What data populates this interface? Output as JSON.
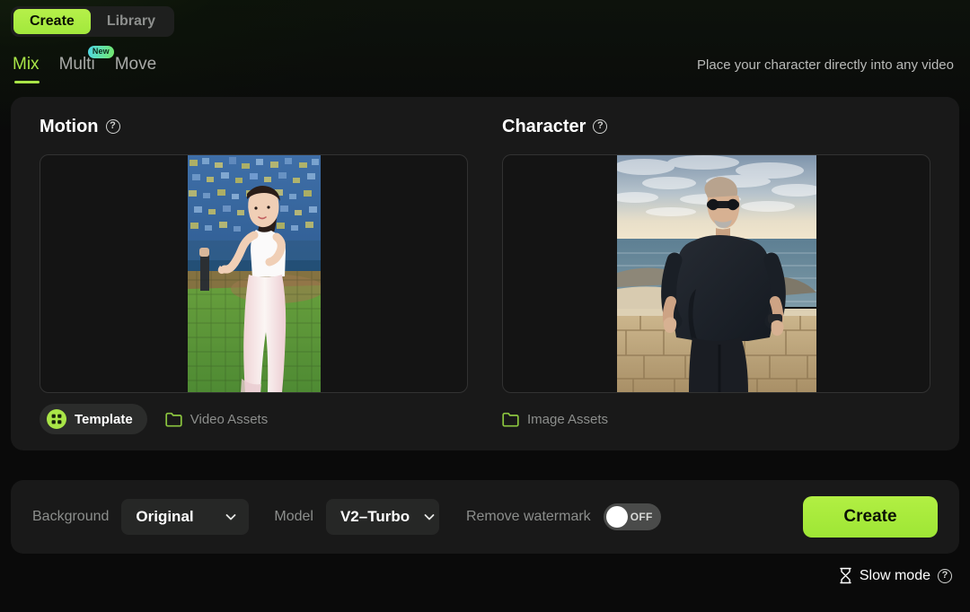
{
  "header": {
    "segments": [
      {
        "label": "Create",
        "active": true
      },
      {
        "label": "Library",
        "active": false
      }
    ],
    "subtabs": [
      {
        "label": "Mix",
        "active": true,
        "badge": null
      },
      {
        "label": "Multi",
        "active": false,
        "badge": "New"
      },
      {
        "label": "Move",
        "active": false,
        "badge": null
      }
    ],
    "tagline": "Place your character directly into any video"
  },
  "panels": {
    "motion": {
      "title": "Motion",
      "help_icon": "question-circle-icon",
      "dropzone_name": "motion-video-dropzone",
      "template_chip": {
        "label": "Template",
        "icon": "grid-dots-icon"
      },
      "assets_button": {
        "label": "Video Assets",
        "icon": "folder-icon"
      }
    },
    "character": {
      "title": "Character",
      "help_icon": "question-circle-icon",
      "dropzone_name": "character-image-dropzone",
      "assets_button": {
        "label": "Image Assets",
        "icon": "folder-icon"
      }
    }
  },
  "controls": {
    "background": {
      "label": "Background",
      "value": "Original",
      "icon": "chevron-down-icon"
    },
    "model": {
      "label": "Model",
      "value": "V2–Turbo",
      "icon": "chevron-down-icon"
    },
    "watermark": {
      "label": "Remove watermark",
      "state": "OFF",
      "enabled": false
    },
    "create_button": "Create"
  },
  "footer": {
    "slow_mode": {
      "label": "Slow mode",
      "icon": "hourglass-icon",
      "help_icon": "question-circle-icon"
    }
  },
  "colors": {
    "accent_green": "#a9e547",
    "button_green": "#a2e83c",
    "badge_cyan": "#4fd8e8",
    "card_bg": "#191919",
    "page_bg": "#0a0a0a"
  }
}
